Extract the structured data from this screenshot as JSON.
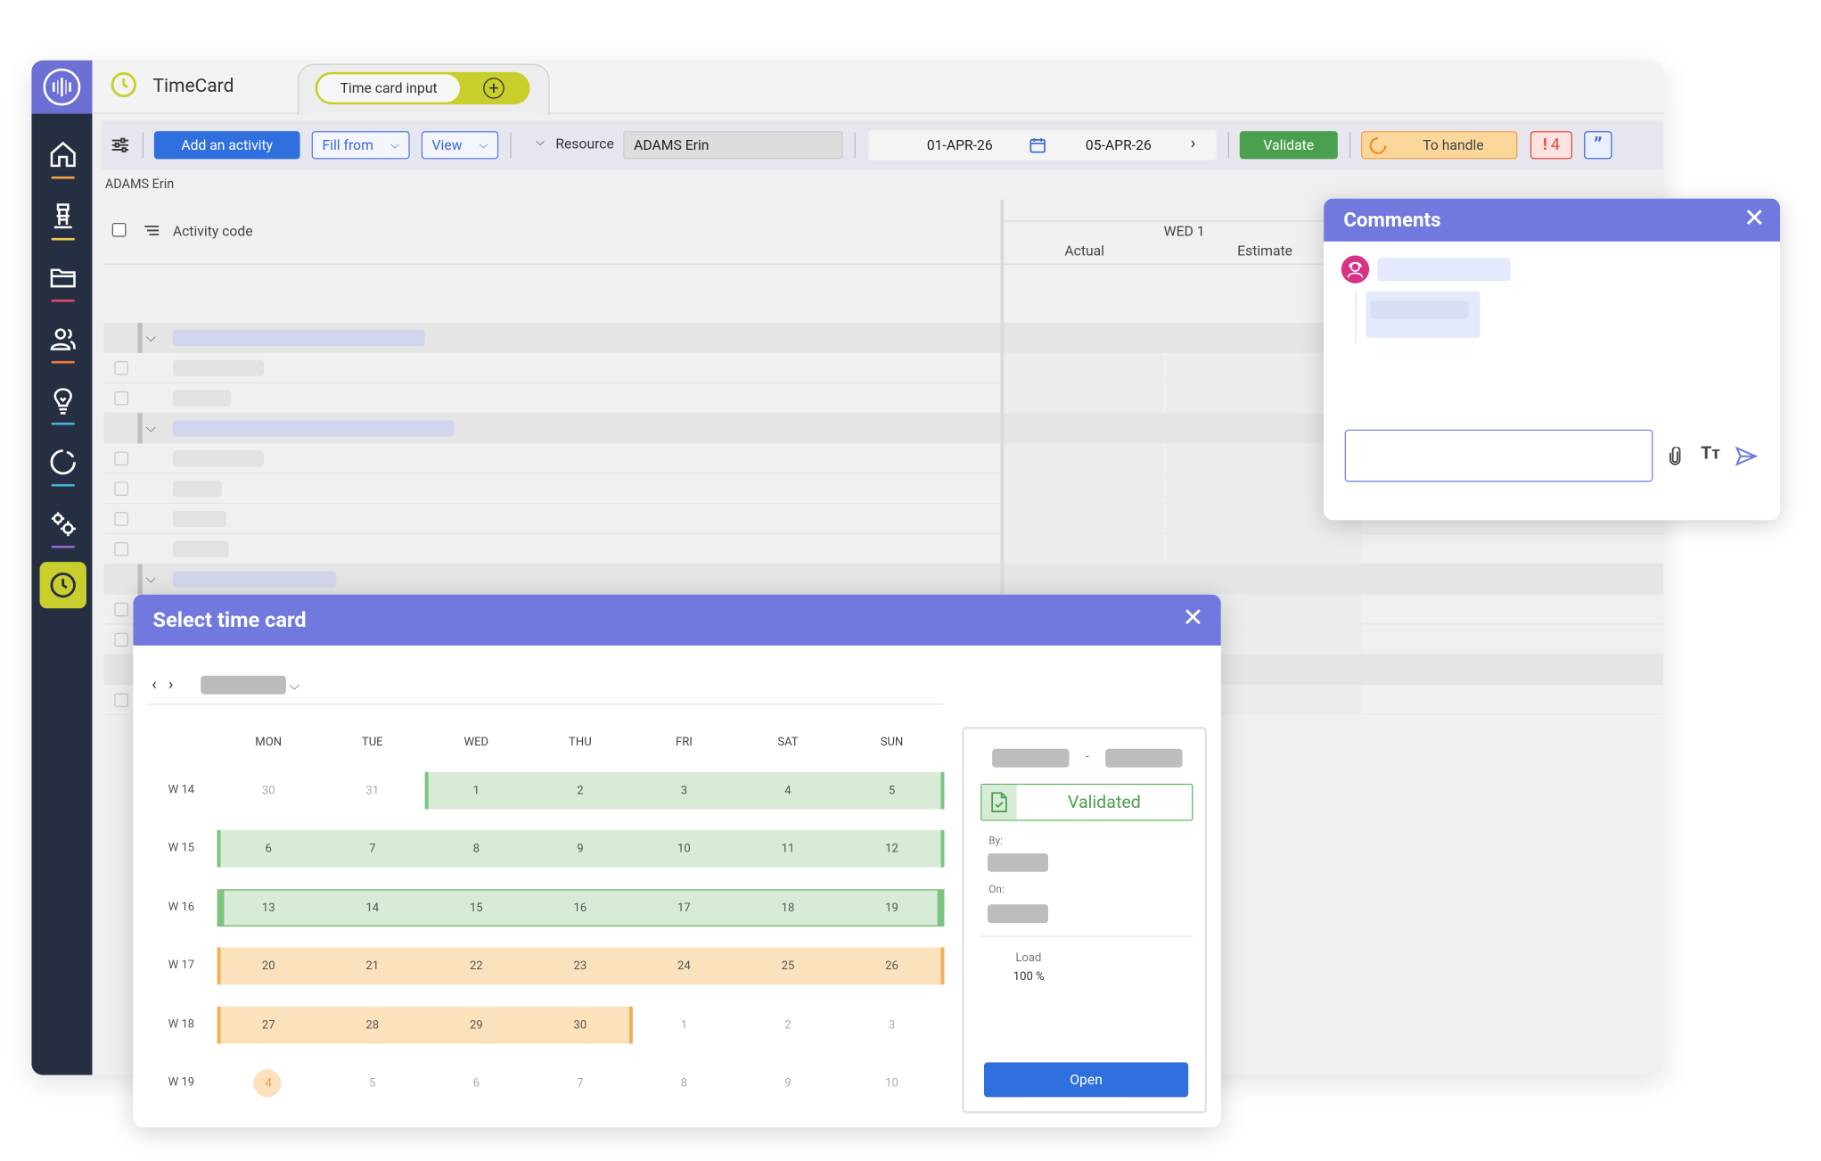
{
  "app": {
    "title": "TimeCard",
    "tab_label": "Time card input"
  },
  "toolbar": {
    "add_activity": "Add an activity",
    "fill_from": "Fill from",
    "view": "View",
    "resource_label": "Resource",
    "resource_value": "ADAMS Erin",
    "date_from": "01-APR-26",
    "date_to": "05-APR-26",
    "validate": "Validate",
    "to_handle": "To handle",
    "alert_count": "4"
  },
  "grid": {
    "resource_name": "ADAMS Erin",
    "col_activity": "Activity code",
    "day_header": "WED 1",
    "sub_actual": "Actual",
    "sub_estimate": "Estimate"
  },
  "comments": {
    "title": "Comments"
  },
  "modal": {
    "title": "Select time card",
    "weekdays": [
      "MON",
      "TUE",
      "WED",
      "THU",
      "FRI",
      "SAT",
      "SUN"
    ],
    "weeks": [
      {
        "label": "W 14",
        "days": [
          "30",
          "31",
          "1",
          "2",
          "3",
          "4",
          "5"
        ]
      },
      {
        "label": "W 15",
        "days": [
          "6",
          "7",
          "8",
          "9",
          "10",
          "11",
          "12"
        ]
      },
      {
        "label": "W 16",
        "days": [
          "13",
          "14",
          "15",
          "16",
          "17",
          "18",
          "19"
        ]
      },
      {
        "label": "W 17",
        "days": [
          "20",
          "21",
          "22",
          "23",
          "24",
          "25",
          "26"
        ]
      },
      {
        "label": "W 18",
        "days": [
          "27",
          "28",
          "29",
          "30",
          "1",
          "2",
          "3"
        ]
      },
      {
        "label": "W 19",
        "days": [
          "4",
          "5",
          "6",
          "7",
          "8",
          "9",
          "10"
        ]
      }
    ],
    "status": "Validated",
    "dash": "-",
    "by_label": "By:",
    "on_label": "On:",
    "load_label": "Load",
    "load_value": "100 %",
    "open_button": "Open"
  },
  "colors": {
    "accent": "#7179de",
    "primary_button": "#2f6fde",
    "validated_green": "#4aa04e",
    "pending_orange": "#f2b05a",
    "nav_background": "#262e42",
    "active_nav": "#c8cf2c"
  }
}
